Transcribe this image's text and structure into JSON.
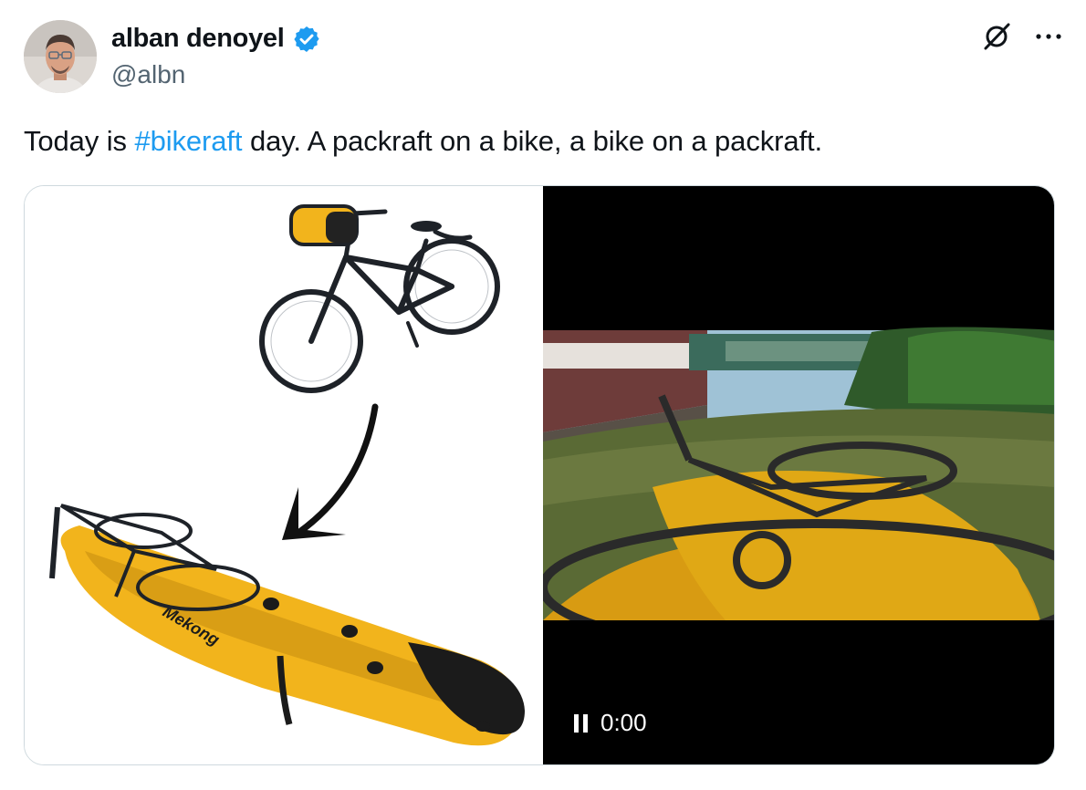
{
  "author": {
    "display_name": "alban denoyel",
    "handle": "@albn",
    "verified_icon": "verified-badge-icon",
    "verified_color": "#1d9bf0"
  },
  "header_actions": {
    "grok_icon": "grok-icon",
    "more_icon": "more-icon"
  },
  "tweet": {
    "text_before": "Today is ",
    "hashtag": "#bikeraft",
    "text_after": " day. A packraft on a bike, a bike on a packraft.",
    "hashtag_color": "#1d9bf0"
  },
  "media": {
    "video": {
      "time": "0:00",
      "pause_icon": "pause-icon"
    },
    "brand_colors": {
      "raft_yellow": "#f2b41c",
      "raft_dark": "#1b1b1b"
    }
  }
}
